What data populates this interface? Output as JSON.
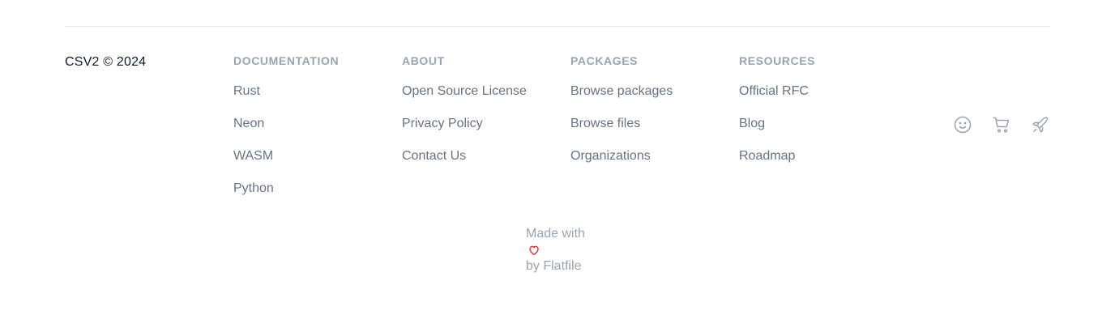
{
  "brand": {
    "text": "CSV2 © 2024"
  },
  "columns": [
    {
      "heading": "Documentation",
      "links": [
        "Rust",
        "Neon",
        "WASM",
        "Python"
      ]
    },
    {
      "heading": "About",
      "links": [
        "Open Source License",
        "Privacy Policy",
        "Contact Us"
      ]
    },
    {
      "heading": "Packages",
      "links": [
        "Browse packages",
        "Browse files",
        "Organizations"
      ]
    },
    {
      "heading": "Resources",
      "links": [
        "Official RFC",
        "Blog",
        "Roadmap"
      ]
    }
  ],
  "social_icons": [
    "smiley-icon",
    "shopping-cart-icon",
    "rocket-icon"
  ],
  "made_with": {
    "prefix": "Made with",
    "suffix_by": "by ",
    "company": "Flatfile",
    "heart_color": "#dc2626"
  },
  "colors": {
    "heading": "#9ca3af",
    "link": "#6b7280",
    "brand": "#111827",
    "divider": "#e5e7eb"
  }
}
